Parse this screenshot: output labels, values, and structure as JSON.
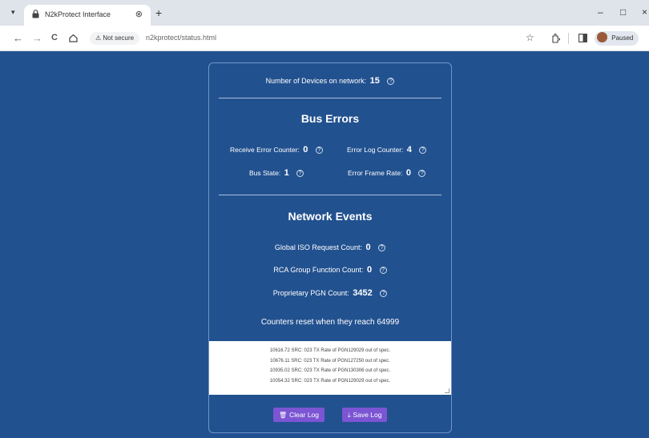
{
  "browser": {
    "tab_menu_icon": "chevron-down-icon",
    "tab_title": "N2kProtect Interface",
    "tab_close": "⊗",
    "new_tab": "+",
    "window": {
      "minimize": "–",
      "restore": "□",
      "close": "×"
    },
    "nav": {
      "back": "←",
      "forward": "→",
      "reload": "C"
    },
    "security_label": "Not secure",
    "url": "n2kprotect/status.html",
    "profile_label": "Paused"
  },
  "status": {
    "devices_label": "Number of Devices on network:",
    "devices_value": "15",
    "help_glyph": "?"
  },
  "bus_errors": {
    "heading": "Bus Errors",
    "receive_error_label": "Receive Error Counter:",
    "receive_error_value": "0",
    "error_log_label": "Error Log Counter:",
    "error_log_value": "4",
    "bus_state_label": "Bus State:",
    "bus_state_value": "1",
    "error_frame_label": "Error Frame Rate:",
    "error_frame_value": "0"
  },
  "network_events": {
    "heading": "Network Events",
    "iso_request_label": "Global ISO Request Count:",
    "iso_request_value": "0",
    "rca_group_label": "RCA Group Function Count:",
    "rca_group_value": "0",
    "proprietary_label": "Proprietary PGN Count:",
    "proprietary_value": "3452",
    "reset_note": "Counters reset when they reach 64999"
  },
  "log": {
    "lines": [
      "10616.72 SRC: 023 TX Rate of PGN129029 out of spec.",
      "10676.11 SRC: 023 TX Rate of PGN127250 out of spec.",
      "10935.02 SRC: 023 TX Rate of PGN130306 out of spec.",
      "10054.32 SRC: 023 TX Rate of PGN129029 out of spec."
    ]
  },
  "buttons": {
    "clear_log": "Clear Log",
    "save_log": "Save Log"
  },
  "colors": {
    "page_background": "#22518f",
    "button": "#7b55d3"
  }
}
